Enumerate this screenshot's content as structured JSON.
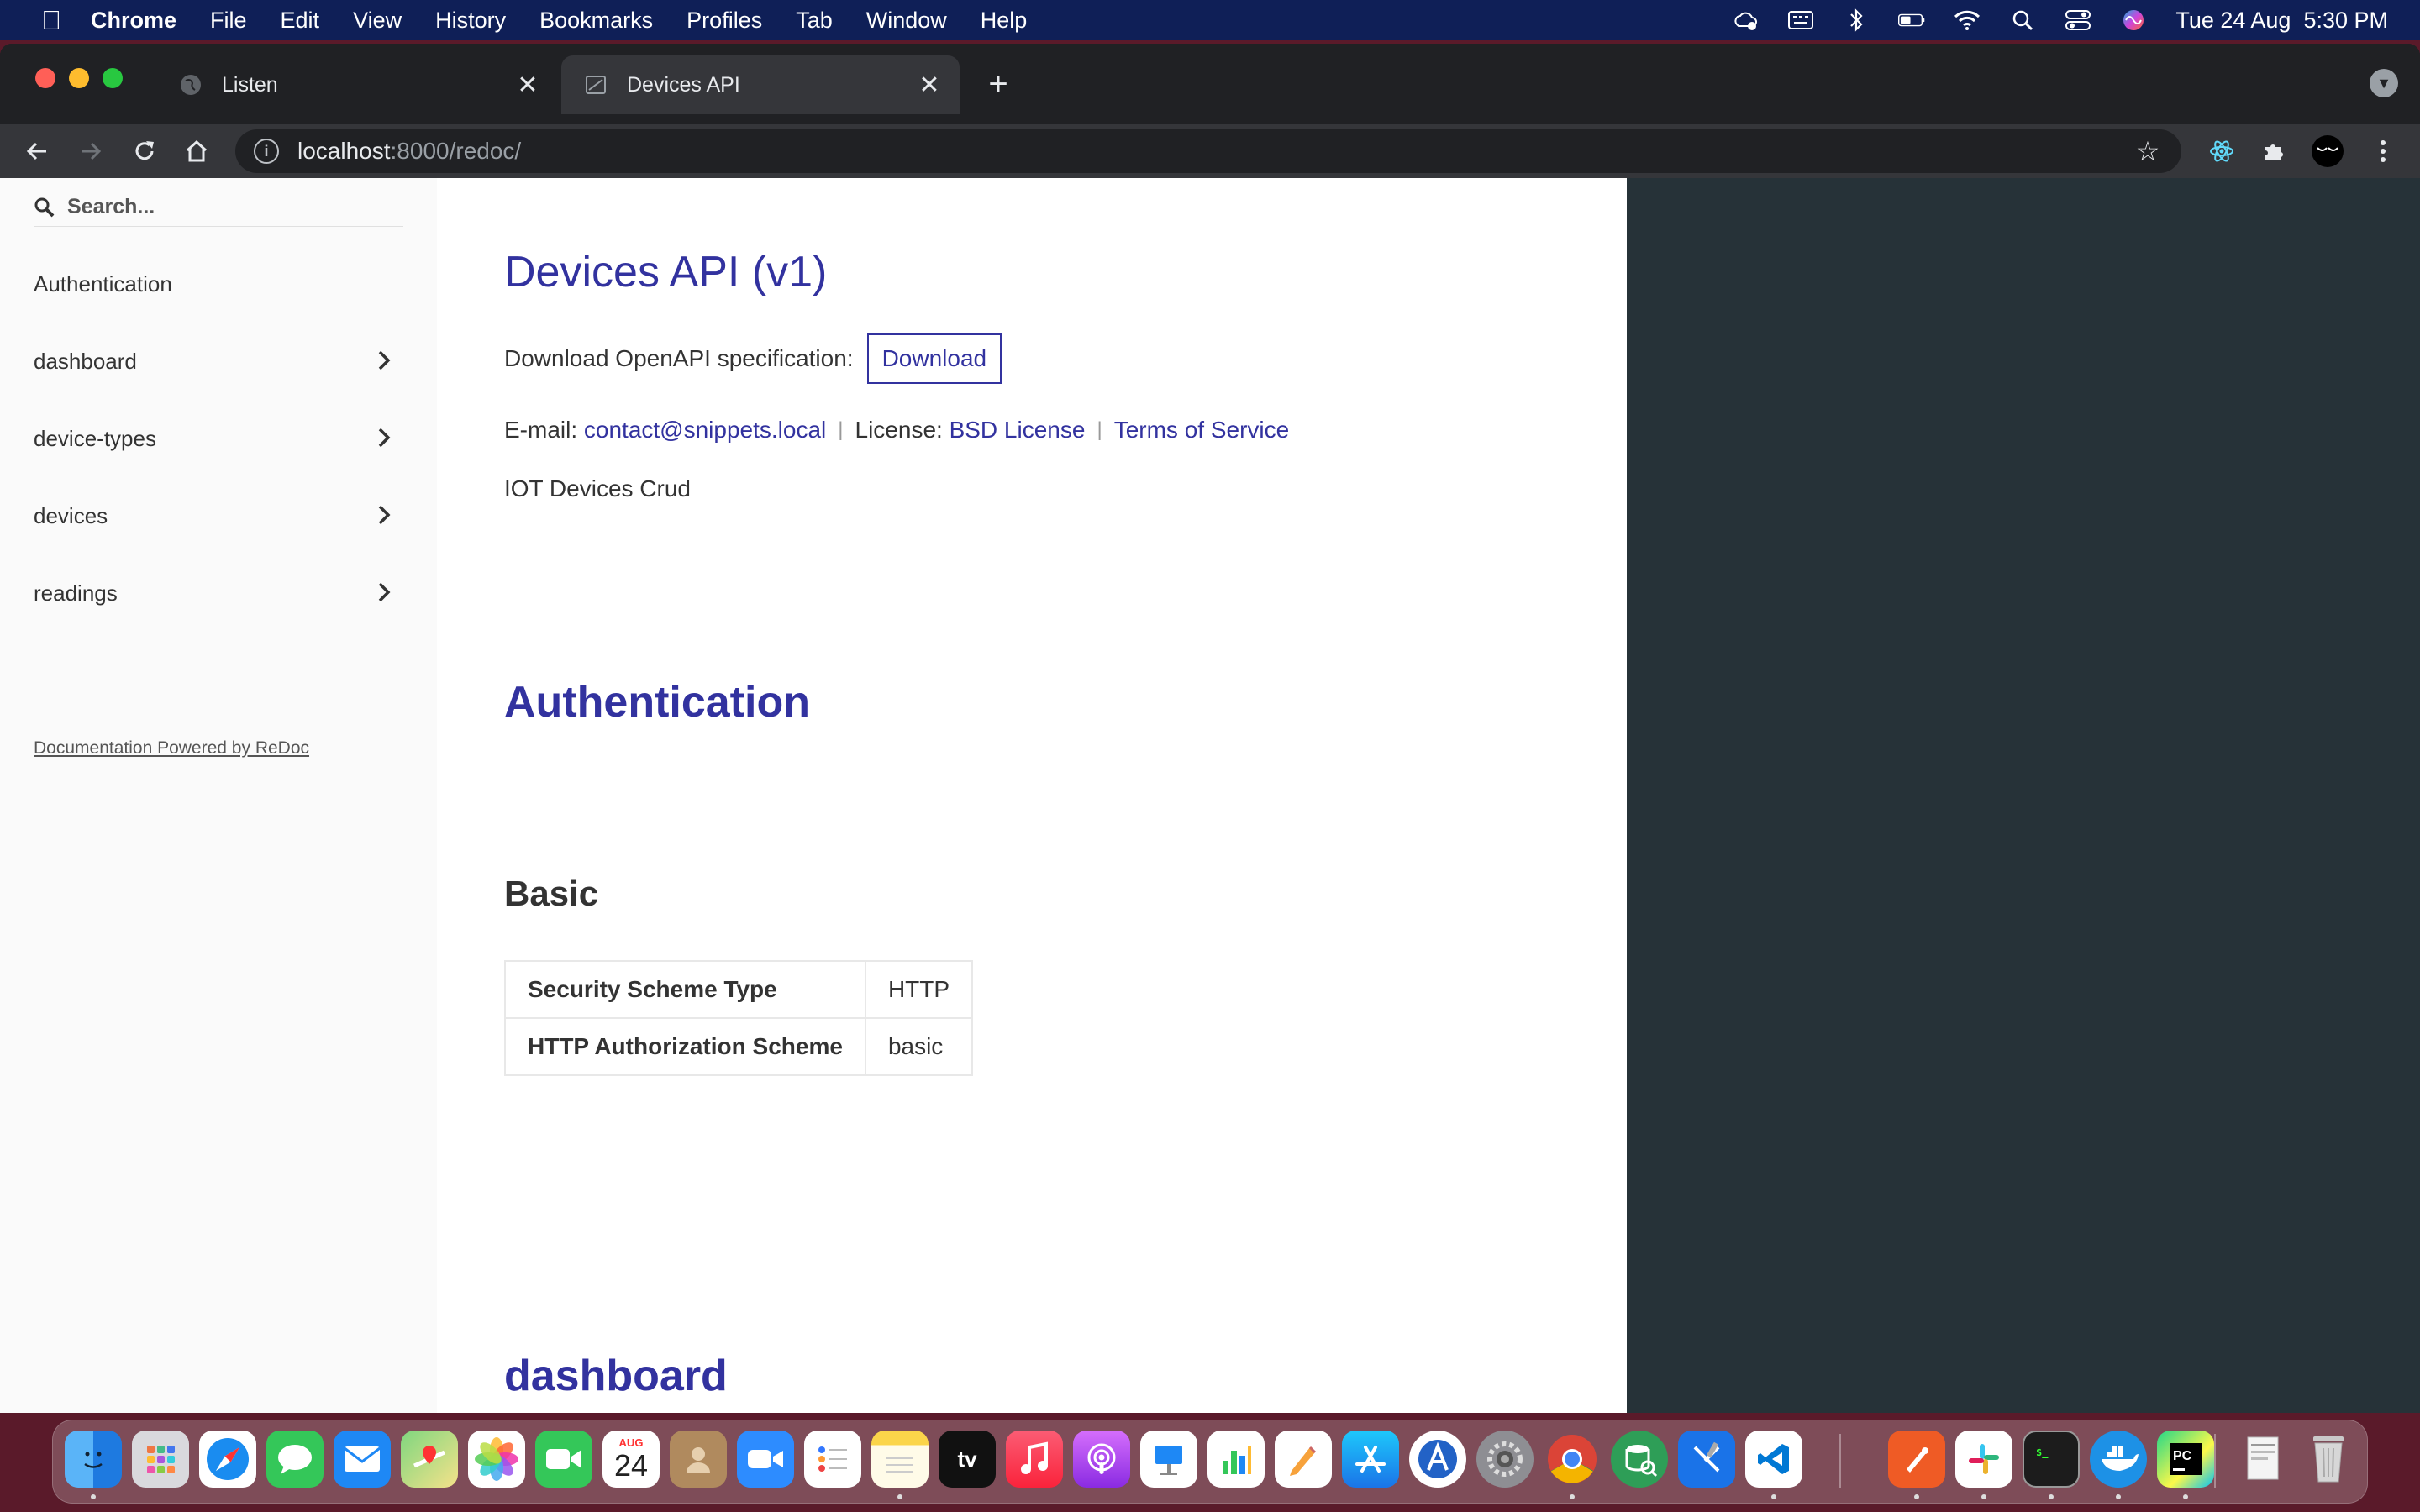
{
  "menubar": {
    "app_name": "Chrome",
    "items": [
      "File",
      "Edit",
      "View",
      "History",
      "Bookmarks",
      "Profiles",
      "Tab",
      "Window",
      "Help"
    ],
    "datetime": "Tue 24 Aug  5:30 PM"
  },
  "tabs": [
    {
      "title": "Listen",
      "active": false
    },
    {
      "title": "Devices API",
      "active": true
    }
  ],
  "address_bar": {
    "host": "localhost",
    "rest": ":8000/redoc/"
  },
  "sidebar": {
    "search_placeholder": "Search...",
    "items": [
      {
        "label": "Authentication",
        "has_chevron": false
      },
      {
        "label": "dashboard",
        "has_chevron": true
      },
      {
        "label": "device-types",
        "has_chevron": true
      },
      {
        "label": "devices",
        "has_chevron": true
      },
      {
        "label": "readings",
        "has_chevron": true
      }
    ],
    "powered_by": "Documentation Powered by ReDoc"
  },
  "main": {
    "title": "Devices API (v1)",
    "download_label": "Download OpenAPI specification:",
    "download_button": "Download",
    "email_label": "E-mail:",
    "email": "contact@snippets.local",
    "license_label": "License:",
    "license": "BSD License",
    "terms": "Terms of Service",
    "description": "IOT Devices Crud",
    "auth_heading": "Authentication",
    "basic_heading": "Basic",
    "scheme_table": [
      {
        "key": "Security Scheme Type",
        "value": "HTTP"
      },
      {
        "key": "HTTP Authorization Scheme",
        "value": "basic"
      }
    ],
    "next_heading": "dashboard"
  },
  "dock": {
    "calendar_month": "AUG",
    "calendar_day": "24",
    "tv_label": "tv"
  },
  "colors": {
    "accent": "#32329f",
    "right_panel": "#263238",
    "menubar": "#0f1f57"
  }
}
